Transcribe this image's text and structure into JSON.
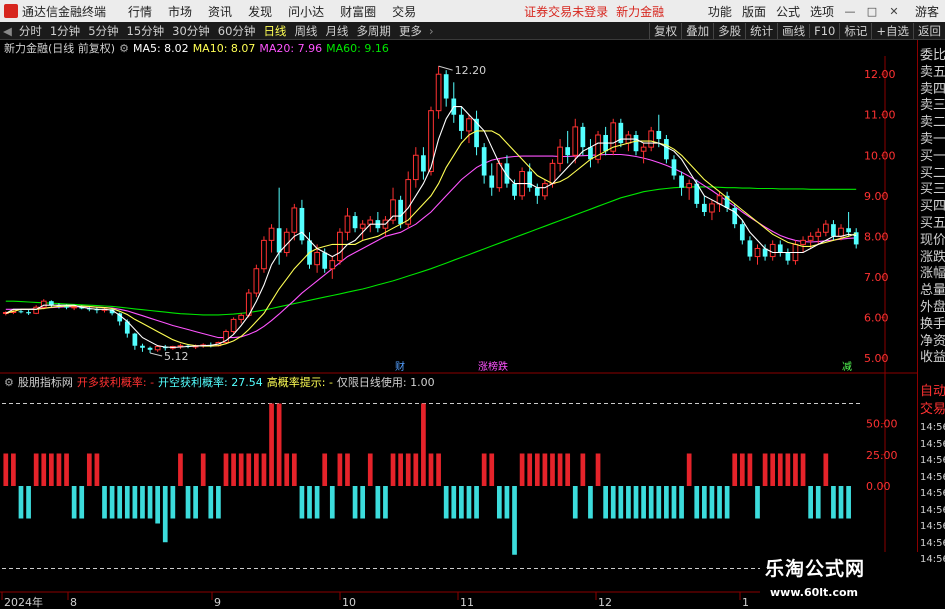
{
  "app": {
    "title": "通达信金融终端",
    "menu": [
      "行情",
      "市场",
      "资讯",
      "发现",
      "问小达",
      "财富圈",
      "交易"
    ],
    "login_warning": "证券交易未登录",
    "stock_name_top": "新力金融",
    "right_menu": [
      "功能",
      "版面",
      "公式",
      "选项"
    ],
    "guest": "游客",
    "win_buttons": [
      "—",
      "□",
      "✕"
    ]
  },
  "periods": {
    "items": [
      "分时",
      "1分钟",
      "5分钟",
      "15分钟",
      "30分钟",
      "60分钟",
      "日线",
      "周线",
      "月线",
      "多周期",
      "更多"
    ],
    "active": "日线",
    "tools": [
      "复权",
      "叠加",
      "多股",
      "统计",
      "画线",
      "F10",
      "标记",
      "+自选",
      "返回"
    ]
  },
  "info": {
    "title": "新力金融(日线 前复权)",
    "ma5": "MA5: 8.02",
    "ma10": "MA10: 8.07",
    "ma20": "MA20: 7.96",
    "ma60": "MA60: 9.16",
    "high_label": "12.20",
    "low_label": "5.12",
    "markers": [
      "财",
      "涨榜跌",
      "减"
    ]
  },
  "indicator": {
    "name": "股朋指标网",
    "l1": "开多获利概率: -",
    "l2": "开空获利概率: 27.54",
    "l3": "高概率提示: -",
    "l4": "仅限日线使用: 1.00",
    "ticks": [
      "50.00",
      "25.00",
      "0.00"
    ]
  },
  "axis": {
    "y_ticks": [
      "12.00",
      "11.00",
      "10.00",
      "9.00",
      "8.00",
      "7.00",
      "6.00",
      "5.00"
    ],
    "x_labels": [
      "2024年",
      "8",
      "9",
      "10",
      "11",
      "12",
      "1"
    ]
  },
  "side": {
    "items": [
      "委比",
      "卖五",
      "卖四",
      "卖三",
      "卖二",
      "卖一",
      "买一",
      "买二",
      "买三",
      "买四",
      "买五",
      "现价",
      "涨跌",
      "涨幅",
      "总量",
      "外盘",
      "换手",
      "净资",
      "收益"
    ],
    "lower": [
      "自动",
      "交易"
    ],
    "times": [
      "14:56",
      "14:56",
      "14:56",
      "14:56",
      "14:56",
      "14:56",
      "14:56",
      "14:56",
      "14:56"
    ]
  },
  "watermark": {
    "line1": "乐淘公式网",
    "line2": "www.60lt.com"
  },
  "colors": {
    "up": "#ff3232",
    "down": "#54ffff",
    "ma5": "#ffffff",
    "ma10": "#ffff54",
    "ma20": "#ff54ff",
    "ma60": "#00e600",
    "bull_bar": "#e5232a",
    "bear_bar": "#3cdcdc"
  },
  "chart_data": {
    "type": "candlestick",
    "ylim": [
      4.8,
      12.4
    ],
    "candles": [
      [
        6.1,
        6.15,
        6.05,
        6.12
      ],
      [
        6.12,
        6.18,
        6.08,
        6.15
      ],
      [
        6.15,
        6.2,
        6.1,
        6.13
      ],
      [
        6.13,
        6.18,
        6.06,
        6.1
      ],
      [
        6.1,
        6.3,
        6.08,
        6.25
      ],
      [
        6.25,
        6.45,
        6.2,
        6.4
      ],
      [
        6.4,
        6.42,
        6.25,
        6.3
      ],
      [
        6.3,
        6.35,
        6.22,
        6.28
      ],
      [
        6.28,
        6.32,
        6.2,
        6.24
      ],
      [
        6.24,
        6.3,
        6.18,
        6.26
      ],
      [
        6.26,
        6.3,
        6.2,
        6.22
      ],
      [
        6.22,
        6.28,
        6.15,
        6.2
      ],
      [
        6.2,
        6.25,
        6.1,
        6.18
      ],
      [
        6.18,
        6.24,
        6.12,
        6.2
      ],
      [
        6.2,
        6.22,
        6.05,
        6.1
      ],
      [
        6.1,
        6.12,
        5.8,
        5.9
      ],
      [
        5.9,
        5.95,
        5.5,
        5.6
      ],
      [
        5.6,
        5.62,
        5.2,
        5.3
      ],
      [
        5.3,
        5.35,
        5.15,
        5.25
      ],
      [
        5.25,
        5.28,
        5.12,
        5.2
      ],
      [
        5.2,
        5.3,
        5.15,
        5.28
      ],
      [
        5.28,
        5.32,
        5.18,
        5.24
      ],
      [
        5.24,
        5.3,
        5.2,
        5.28
      ],
      [
        5.28,
        5.35,
        5.22,
        5.3
      ],
      [
        5.3,
        5.34,
        5.24,
        5.27
      ],
      [
        5.27,
        5.33,
        5.22,
        5.3
      ],
      [
        5.3,
        5.36,
        5.25,
        5.32
      ],
      [
        5.32,
        5.38,
        5.26,
        5.3
      ],
      [
        5.3,
        5.4,
        5.28,
        5.38
      ],
      [
        5.38,
        5.7,
        5.35,
        5.65
      ],
      [
        5.65,
        6.0,
        5.6,
        5.95
      ],
      [
        5.95,
        6.1,
        5.85,
        6.05
      ],
      [
        6.05,
        6.7,
        6.0,
        6.6
      ],
      [
        6.6,
        7.3,
        6.5,
        7.2
      ],
      [
        7.2,
        8.0,
        7.1,
        7.9
      ],
      [
        7.9,
        8.3,
        7.6,
        8.2
      ],
      [
        8.2,
        9.2,
        7.3,
        7.6
      ],
      [
        7.6,
        8.2,
        7.5,
        8.1
      ],
      [
        8.1,
        8.8,
        7.9,
        8.7
      ],
      [
        8.7,
        8.9,
        7.8,
        7.9
      ],
      [
        7.9,
        8.1,
        7.2,
        7.3
      ],
      [
        7.3,
        7.8,
        7.1,
        7.6
      ],
      [
        7.6,
        7.7,
        7.1,
        7.2
      ],
      [
        7.2,
        7.5,
        6.95,
        7.4
      ],
      [
        7.4,
        8.2,
        7.3,
        8.1
      ],
      [
        8.1,
        8.7,
        7.9,
        8.5
      ],
      [
        8.5,
        8.6,
        8.1,
        8.2
      ],
      [
        8.2,
        8.4,
        7.9,
        8.3
      ],
      [
        8.3,
        8.5,
        8.1,
        8.4
      ],
      [
        8.4,
        8.6,
        8.1,
        8.2
      ],
      [
        8.2,
        8.5,
        8.0,
        8.4
      ],
      [
        8.4,
        9.2,
        8.3,
        8.9
      ],
      [
        8.9,
        9.0,
        8.2,
        8.3
      ],
      [
        8.3,
        9.6,
        8.2,
        9.4
      ],
      [
        9.4,
        10.2,
        9.2,
        10.0
      ],
      [
        10.0,
        10.2,
        9.4,
        9.6
      ],
      [
        9.6,
        11.2,
        9.5,
        11.1
      ],
      [
        11.1,
        12.2,
        10.9,
        12.0
      ],
      [
        12.0,
        12.1,
        11.2,
        11.4
      ],
      [
        11.4,
        11.8,
        10.8,
        11.0
      ],
      [
        11.0,
        11.2,
        10.4,
        10.6
      ],
      [
        10.6,
        11.0,
        10.3,
        10.9
      ],
      [
        10.9,
        11.1,
        10.0,
        10.2
      ],
      [
        10.2,
        10.3,
        9.3,
        9.5
      ],
      [
        9.5,
        9.8,
        9.0,
        9.2
      ],
      [
        9.2,
        9.9,
        9.1,
        9.8
      ],
      [
        9.8,
        10.0,
        9.2,
        9.3
      ],
      [
        9.3,
        9.4,
        8.9,
        9.0
      ],
      [
        9.0,
        9.7,
        8.9,
        9.6
      ],
      [
        9.6,
        9.8,
        9.1,
        9.2
      ],
      [
        9.2,
        9.3,
        8.8,
        9.0
      ],
      [
        9.0,
        9.4,
        8.9,
        9.3
      ],
      [
        9.3,
        9.9,
        9.2,
        9.8
      ],
      [
        9.8,
        10.4,
        9.6,
        10.2
      ],
      [
        10.2,
        10.6,
        9.8,
        10.0
      ],
      [
        10.0,
        10.9,
        9.8,
        10.7
      ],
      [
        10.7,
        10.8,
        10.0,
        10.2
      ],
      [
        10.2,
        10.4,
        9.7,
        9.9
      ],
      [
        9.9,
        10.6,
        9.8,
        10.5
      ],
      [
        10.5,
        10.7,
        10.0,
        10.1
      ],
      [
        10.1,
        10.9,
        10.0,
        10.8
      ],
      [
        10.8,
        10.9,
        10.2,
        10.3
      ],
      [
        10.3,
        10.6,
        10.1,
        10.5
      ],
      [
        10.5,
        10.6,
        10.0,
        10.1
      ],
      [
        10.1,
        10.3,
        9.8,
        10.2
      ],
      [
        10.2,
        10.7,
        10.1,
        10.6
      ],
      [
        10.6,
        11.0,
        10.2,
        10.4
      ],
      [
        10.4,
        10.5,
        9.8,
        9.9
      ],
      [
        9.9,
        10.0,
        9.4,
        9.5
      ],
      [
        9.5,
        9.6,
        9.0,
        9.2
      ],
      [
        9.2,
        9.4,
        8.9,
        9.3
      ],
      [
        9.3,
        9.4,
        8.7,
        8.8
      ],
      [
        8.8,
        9.0,
        8.5,
        8.6
      ],
      [
        8.6,
        8.9,
        8.4,
        8.8
      ],
      [
        8.8,
        9.1,
        8.6,
        9.0
      ],
      [
        9.0,
        9.1,
        8.6,
        8.7
      ],
      [
        8.7,
        8.8,
        8.2,
        8.3
      ],
      [
        8.3,
        8.4,
        7.8,
        7.9
      ],
      [
        7.9,
        8.0,
        7.4,
        7.5
      ],
      [
        7.5,
        7.8,
        7.3,
        7.7
      ],
      [
        7.7,
        7.8,
        7.4,
        7.5
      ],
      [
        7.5,
        7.9,
        7.4,
        7.8
      ],
      [
        7.8,
        7.9,
        7.5,
        7.6
      ],
      [
        7.6,
        7.7,
        7.3,
        7.4
      ],
      [
        7.4,
        7.9,
        7.3,
        7.8
      ],
      [
        7.8,
        8.0,
        7.6,
        7.9
      ],
      [
        7.9,
        8.1,
        7.7,
        8.0
      ],
      [
        8.0,
        8.2,
        7.8,
        8.1
      ],
      [
        8.1,
        8.4,
        8.0,
        8.3
      ],
      [
        8.3,
        8.4,
        7.9,
        8.0
      ],
      [
        8.0,
        8.3,
        7.9,
        8.2
      ],
      [
        8.2,
        8.6,
        8.0,
        8.1
      ],
      [
        8.1,
        8.2,
        7.7,
        7.8
      ]
    ],
    "ma5": [
      6.1,
      6.2,
      6.2,
      6.2,
      6.2,
      6.3,
      6.3,
      6.3,
      6.3,
      6.3,
      6.25,
      6.22,
      6.2,
      6.2,
      6.18,
      6.05,
      5.9,
      5.7,
      5.5,
      5.4,
      5.3,
      5.27,
      5.26,
      5.27,
      5.28,
      5.29,
      5.3,
      5.31,
      5.34,
      5.43,
      5.58,
      5.8,
      6.05,
      6.4,
      6.8,
      7.3,
      7.6,
      7.8,
      8.0,
      8.1,
      7.9,
      7.7,
      7.6,
      7.5,
      7.6,
      7.8,
      7.9,
      8.1,
      8.3,
      8.3,
      8.3,
      8.5,
      8.5,
      8.7,
      9.0,
      9.3,
      9.7,
      10.4,
      10.9,
      11.2,
      11.2,
      11.0,
      10.8,
      10.6,
      10.2,
      9.8,
      9.5,
      9.3,
      9.3,
      9.3,
      9.2,
      9.2,
      9.3,
      9.5,
      9.7,
      9.9,
      10.1,
      10.2,
      10.3,
      10.3,
      10.3,
      10.4,
      10.4,
      10.4,
      10.3,
      10.3,
      10.3,
      10.2,
      10.1,
      9.9,
      9.6,
      9.3,
      9.0,
      8.9,
      8.8,
      8.7,
      8.6,
      8.4,
      8.1,
      7.9,
      7.7,
      7.6,
      7.6,
      7.6,
      7.6,
      7.6,
      7.7,
      7.8,
      7.9,
      8.0,
      8.0,
      8.05,
      8.02
    ],
    "ma10": [
      6.1,
      6.15,
      6.2,
      6.2,
      6.2,
      6.22,
      6.25,
      6.27,
      6.28,
      6.28,
      6.28,
      6.27,
      6.25,
      6.24,
      6.22,
      6.15,
      6.07,
      5.95,
      5.85,
      5.75,
      5.65,
      5.55,
      5.45,
      5.38,
      5.33,
      5.3,
      5.29,
      5.29,
      5.3,
      5.35,
      5.42,
      5.53,
      5.7,
      5.9,
      6.1,
      6.4,
      6.7,
      6.95,
      7.2,
      7.4,
      7.6,
      7.7,
      7.75,
      7.8,
      7.8,
      7.8,
      7.8,
      7.9,
      7.95,
      8.0,
      8.1,
      8.2,
      8.3,
      8.4,
      8.6,
      8.8,
      9.0,
      9.3,
      9.7,
      10.0,
      10.3,
      10.5,
      10.6,
      10.6,
      10.6,
      10.5,
      10.3,
      10.1,
      9.9,
      9.7,
      9.5,
      9.4,
      9.3,
      9.35,
      9.45,
      9.6,
      9.75,
      9.9,
      10.0,
      10.1,
      10.2,
      10.25,
      10.3,
      10.35,
      10.35,
      10.35,
      10.3,
      10.25,
      10.15,
      10.0,
      9.8,
      9.6,
      9.4,
      9.25,
      9.1,
      8.95,
      8.8,
      8.65,
      8.5,
      8.35,
      8.2,
      8.05,
      7.95,
      7.85,
      7.8,
      7.75,
      7.75,
      7.8,
      7.85,
      7.9,
      7.95,
      8.0,
      8.07
    ],
    "ma20": [
      6.2,
      6.2,
      6.2,
      6.2,
      6.22,
      6.23,
      6.24,
      6.25,
      6.26,
      6.26,
      6.26,
      6.26,
      6.25,
      6.24,
      6.23,
      6.2,
      6.16,
      6.1,
      6.04,
      5.98,
      5.92,
      5.86,
      5.8,
      5.75,
      5.7,
      5.65,
      5.6,
      5.55,
      5.5,
      5.5,
      5.5,
      5.52,
      5.58,
      5.66,
      5.78,
      5.92,
      6.08,
      6.25,
      6.42,
      6.6,
      6.75,
      6.9,
      7.05,
      7.2,
      7.35,
      7.5,
      7.6,
      7.7,
      7.8,
      7.9,
      8.0,
      8.05,
      8.1,
      8.2,
      8.3,
      8.45,
      8.6,
      8.8,
      9.0,
      9.2,
      9.4,
      9.55,
      9.7,
      9.8,
      9.88,
      9.92,
      9.95,
      9.97,
      9.98,
      9.98,
      9.98,
      9.98,
      9.98,
      9.97,
      9.97,
      9.98,
      9.99,
      10.0,
      10.01,
      10.02,
      10.02,
      10.02,
      10.0,
      9.97,
      9.93,
      9.88,
      9.82,
      9.75,
      9.67,
      9.58,
      9.48,
      9.37,
      9.25,
      9.13,
      9.0,
      8.87,
      8.74,
      8.6,
      8.47,
      8.35,
      8.23,
      8.12,
      8.02,
      7.95,
      7.9,
      7.87,
      7.86,
      7.87,
      7.89,
      7.91,
      7.93,
      7.95,
      7.96
    ],
    "ma60": [
      6.4,
      6.4,
      6.39,
      6.38,
      6.37,
      6.36,
      6.35,
      6.34,
      6.33,
      6.32,
      6.31,
      6.3,
      6.29,
      6.28,
      6.27,
      6.25,
      6.23,
      6.21,
      6.19,
      6.17,
      6.15,
      6.13,
      6.11,
      6.09,
      6.08,
      6.07,
      6.06,
      6.06,
      6.06,
      6.07,
      6.08,
      6.1,
      6.12,
      6.15,
      6.18,
      6.22,
      6.26,
      6.3,
      6.34,
      6.38,
      6.42,
      6.46,
      6.5,
      6.54,
      6.58,
      6.62,
      6.66,
      6.7,
      6.75,
      6.8,
      6.85,
      6.9,
      6.96,
      7.02,
      7.08,
      7.14,
      7.2,
      7.27,
      7.34,
      7.41,
      7.48,
      7.55,
      7.62,
      7.69,
      7.76,
      7.83,
      7.9,
      7.97,
      8.04,
      8.11,
      8.18,
      8.25,
      8.32,
      8.39,
      8.46,
      8.53,
      8.6,
      8.67,
      8.74,
      8.81,
      8.88,
      8.95,
      9.0,
      9.05,
      9.1,
      9.13,
      9.16,
      9.18,
      9.2,
      9.21,
      9.22,
      9.22,
      9.22,
      9.22,
      9.21,
      9.2,
      9.2,
      9.19,
      9.19,
      9.18,
      9.18,
      9.18,
      9.17,
      9.17,
      9.17,
      9.17,
      9.16,
      9.16,
      9.16,
      9.16,
      9.16,
      9.16,
      9.16
    ],
    "indicator_bars": [
      [
        1,
        26
      ],
      [
        1,
        26
      ],
      [
        0,
        -26
      ],
      [
        0,
        -26
      ],
      [
        1,
        26
      ],
      [
        1,
        26
      ],
      [
        1,
        26
      ],
      [
        1,
        26
      ],
      [
        1,
        26
      ],
      [
        0,
        -26
      ],
      [
        0,
        -26
      ],
      [
        1,
        26
      ],
      [
        1,
        26
      ],
      [
        0,
        -26
      ],
      [
        0,
        -26
      ],
      [
        0,
        -26
      ],
      [
        0,
        -26
      ],
      [
        0,
        -26
      ],
      [
        0,
        -26
      ],
      [
        0,
        -26
      ],
      [
        0,
        -30
      ],
      [
        0,
        -45
      ],
      [
        0,
        -26
      ],
      [
        1,
        26
      ],
      [
        0,
        -26
      ],
      [
        0,
        -26
      ],
      [
        1,
        26
      ],
      [
        0,
        -26
      ],
      [
        0,
        -26
      ],
      [
        1,
        26
      ],
      [
        1,
        26
      ],
      [
        1,
        26
      ],
      [
        1,
        26
      ],
      [
        1,
        26
      ],
      [
        1,
        26
      ],
      [
        1,
        66
      ],
      [
        1,
        66
      ],
      [
        1,
        26
      ],
      [
        1,
        26
      ],
      [
        0,
        -26
      ],
      [
        0,
        -26
      ],
      [
        0,
        -26
      ],
      [
        1,
        26
      ],
      [
        0,
        -26
      ],
      [
        1,
        26
      ],
      [
        1,
        26
      ],
      [
        0,
        -26
      ],
      [
        0,
        -26
      ],
      [
        1,
        26
      ],
      [
        0,
        -26
      ],
      [
        0,
        -26
      ],
      [
        1,
        26
      ],
      [
        1,
        26
      ],
      [
        1,
        26
      ],
      [
        1,
        26
      ],
      [
        1,
        66
      ],
      [
        1,
        26
      ],
      [
        1,
        26
      ],
      [
        0,
        -26
      ],
      [
        0,
        -26
      ],
      [
        0,
        -26
      ],
      [
        0,
        -26
      ],
      [
        0,
        -26
      ],
      [
        1,
        26
      ],
      [
        1,
        26
      ],
      [
        0,
        -26
      ],
      [
        0,
        -26
      ],
      [
        0,
        -55
      ],
      [
        1,
        26
      ],
      [
        1,
        26
      ],
      [
        1,
        26
      ],
      [
        1,
        26
      ],
      [
        1,
        26
      ],
      [
        1,
        26
      ],
      [
        1,
        26
      ],
      [
        0,
        -26
      ],
      [
        1,
        26
      ],
      [
        0,
        -26
      ],
      [
        1,
        26
      ],
      [
        0,
        -26
      ],
      [
        0,
        -26
      ],
      [
        0,
        -26
      ],
      [
        0,
        -26
      ],
      [
        0,
        -26
      ],
      [
        0,
        -26
      ],
      [
        0,
        -26
      ],
      [
        0,
        -26
      ],
      [
        0,
        -26
      ],
      [
        0,
        -26
      ],
      [
        0,
        -26
      ],
      [
        1,
        26
      ],
      [
        0,
        -26
      ],
      [
        0,
        -26
      ],
      [
        0,
        -26
      ],
      [
        0,
        -26
      ],
      [
        0,
        -26
      ],
      [
        1,
        26
      ],
      [
        1,
        26
      ],
      [
        1,
        26
      ],
      [
        0,
        -26
      ],
      [
        1,
        26
      ],
      [
        1,
        26
      ],
      [
        1,
        26
      ],
      [
        1,
        26
      ],
      [
        1,
        26
      ],
      [
        1,
        26
      ],
      [
        0,
        -26
      ],
      [
        0,
        -26
      ],
      [
        1,
        26
      ],
      [
        0,
        -26
      ],
      [
        0,
        -26
      ],
      [
        0,
        -26
      ]
    ]
  }
}
